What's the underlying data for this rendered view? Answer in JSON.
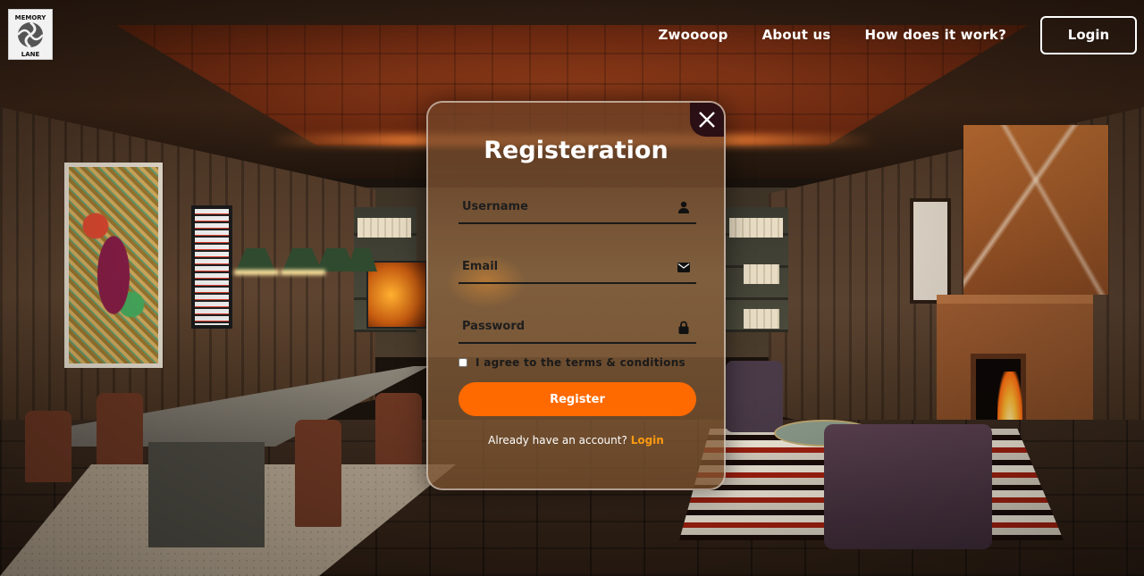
{
  "brand": {
    "logo_line1": "MEMORY",
    "logo_line2": "LANE"
  },
  "nav": {
    "items": [
      "Zwoooop",
      "About us",
      "How does it work?"
    ],
    "login_label": "Login"
  },
  "modal": {
    "title": "Registeration",
    "username_placeholder": "Username",
    "email_placeholder": "Email",
    "password_placeholder": "Password",
    "terms_label": "I agree to the terms & conditions",
    "terms_checked": false,
    "register_label": "Register",
    "already_text": "Already have an account?",
    "login_link": "Login",
    "close_icon": "close-icon"
  },
  "colors": {
    "accent": "#ff6a00",
    "link": "#ff9a10",
    "close_bg": "#2a0f14"
  }
}
